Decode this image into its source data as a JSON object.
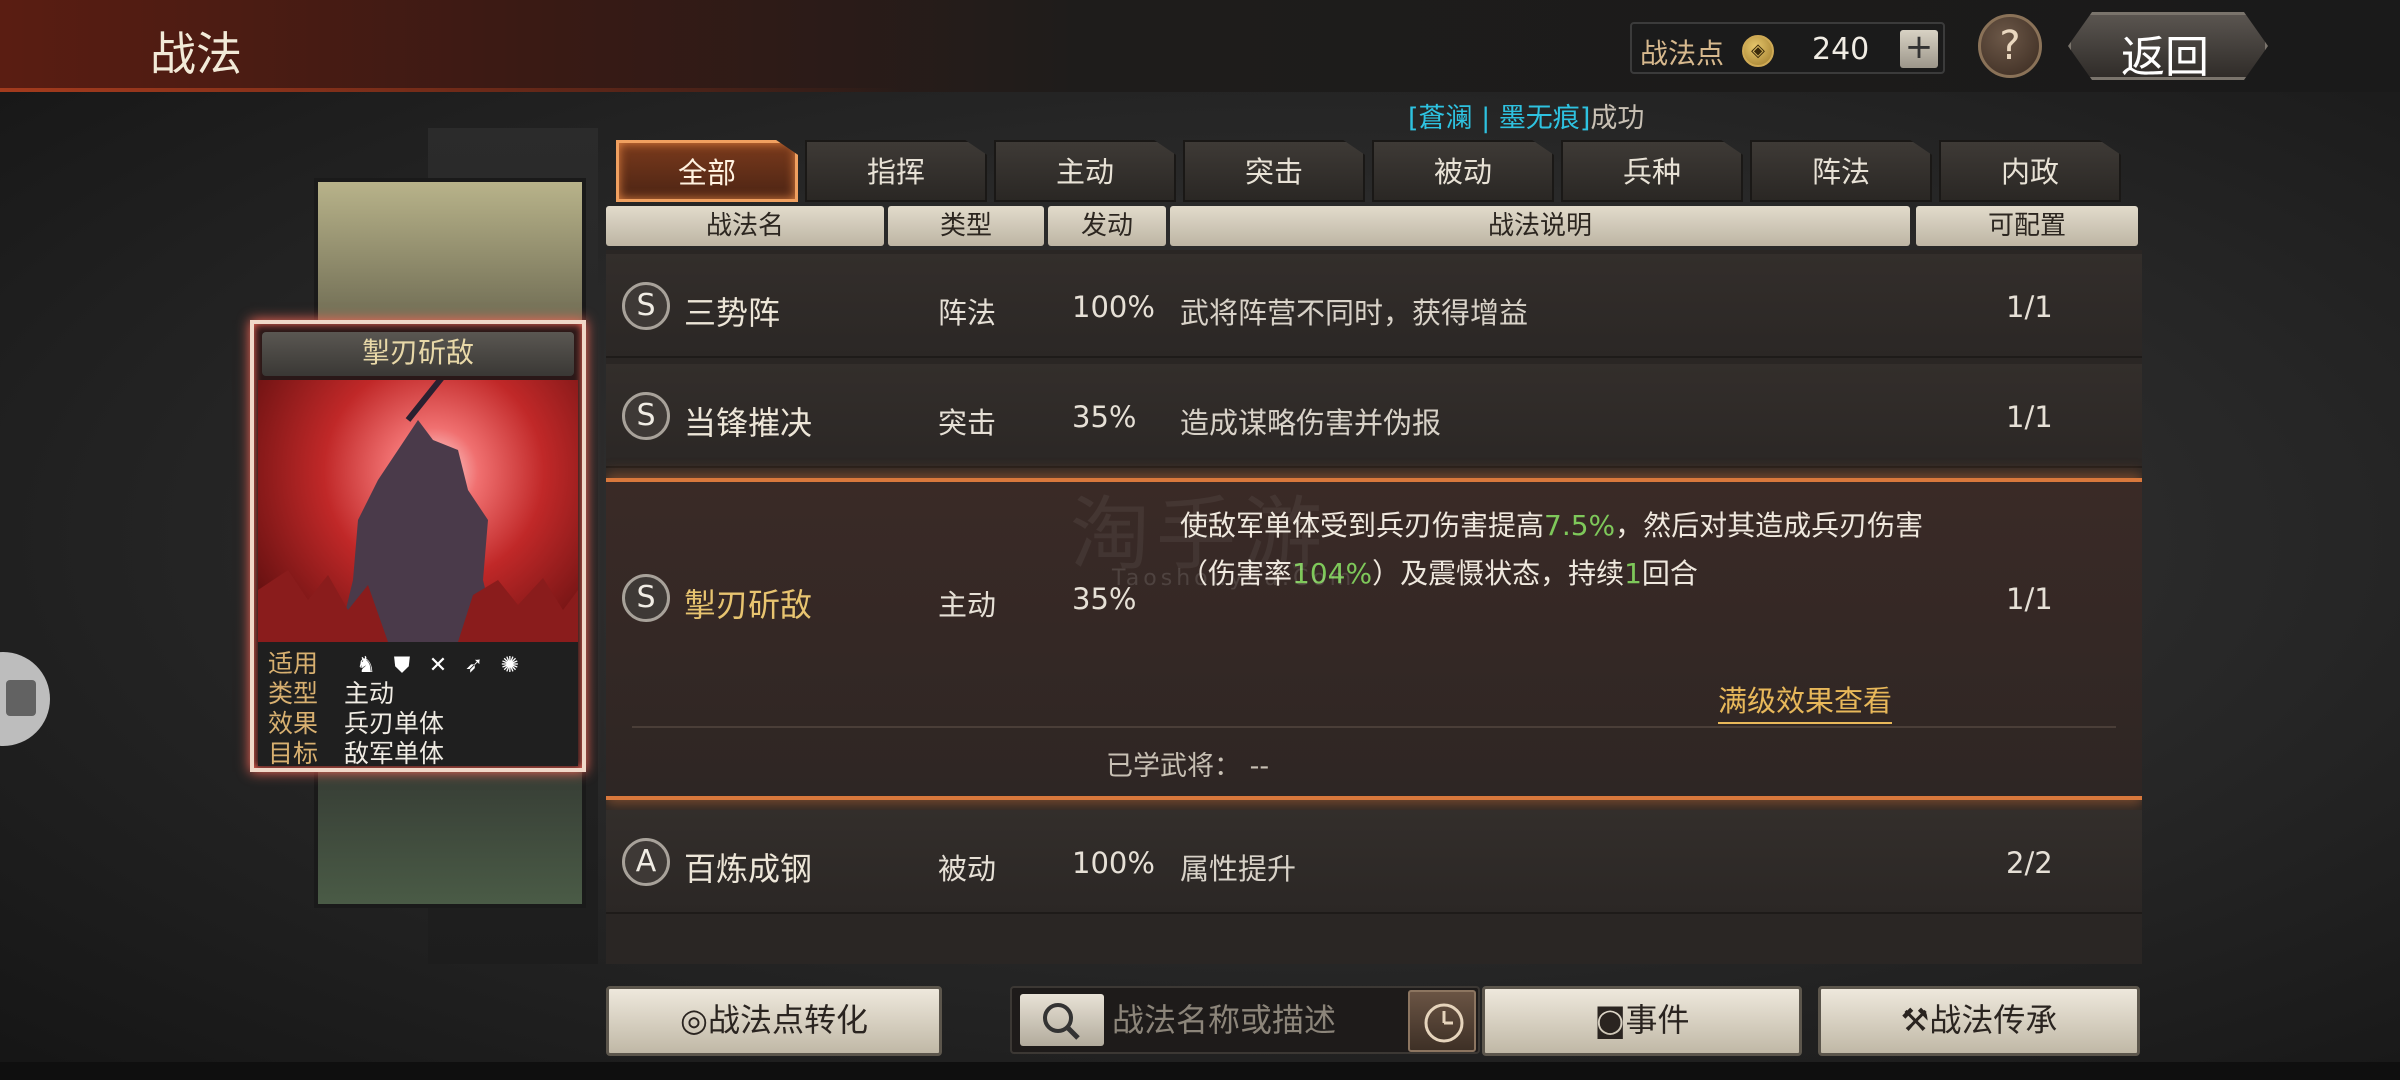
{
  "header": {
    "title": "战法",
    "points_label": "战法点",
    "points_value": "240",
    "add_label": "+",
    "help_label": "?",
    "back_label": "返回"
  },
  "notice": {
    "bracket_open": "[",
    "name1": "蒼澜",
    "sep": " | ",
    "name2": "墨无痕",
    "bracket_close": "]",
    "suffix": "成功"
  },
  "skill_card": {
    "title": "掣刃斫敌",
    "applicable_label": "适用",
    "type_label": "类型",
    "type_value": "主动",
    "effect_label": "效果",
    "effect_value": "兵刃单体",
    "target_label": "目标",
    "target_value": "敌军单体",
    "troop_icons": [
      "cavalry-icon",
      "shield-icon",
      "archer-icon",
      "spear-icon",
      "vehicle-icon"
    ]
  },
  "tabs": [
    {
      "label": "全部",
      "active": true
    },
    {
      "label": "指挥",
      "active": false
    },
    {
      "label": "主动",
      "active": false
    },
    {
      "label": "突击",
      "active": false
    },
    {
      "label": "被动",
      "active": false
    },
    {
      "label": "兵种",
      "active": false
    },
    {
      "label": "阵法",
      "active": false
    },
    {
      "label": "内政",
      "active": false
    }
  ],
  "columns": {
    "name": "战法名",
    "type": "类型",
    "rate": "发动",
    "desc": "战法说明",
    "qty": "可配置"
  },
  "rows": [
    {
      "grade": "S",
      "name": "三势阵",
      "type": "阵法",
      "rate": "100%",
      "desc": "武将阵营不同时，获得增益",
      "qty": "1/1"
    },
    {
      "grade": "S",
      "name": "当锋摧决",
      "type": "突击",
      "rate": "35%",
      "desc": "造成谋略伤害并伪报",
      "qty": "1/1"
    },
    {
      "grade": "S",
      "name": "掣刃斫敌",
      "type": "主动",
      "rate": "35%",
      "qty": "1/1",
      "desc_p1": "使敌军单体受到兵刃伤害提高",
      "desc_h1": "7.5%",
      "desc_p2": "，然后对其造成兵刃伤害（伤害率",
      "desc_h2": "104%",
      "desc_p3": "）及震慑状态，持续",
      "desc_h3": "1",
      "desc_p4": "回合",
      "full_effect": "满级效果查看",
      "learned": "已学武将：  --"
    },
    {
      "grade": "A",
      "name": "百炼成钢",
      "type": "被动",
      "rate": "100%",
      "desc": "属性提升",
      "qty": "2/2"
    }
  ],
  "bottom": {
    "convert_label": "战法点转化",
    "search_placeholder": "战法名称或描述",
    "event_label": "事件",
    "inherit_label": "战法传承"
  },
  "watermark": {
    "main": "淘手游",
    "sub": "Taoshouyou.Com"
  },
  "colors": {
    "accent_orange": "#d9783c",
    "highlight_green": "#7ec85a",
    "gold_text": "#e8b85a",
    "notice_cyan": "#2ec2e0"
  }
}
